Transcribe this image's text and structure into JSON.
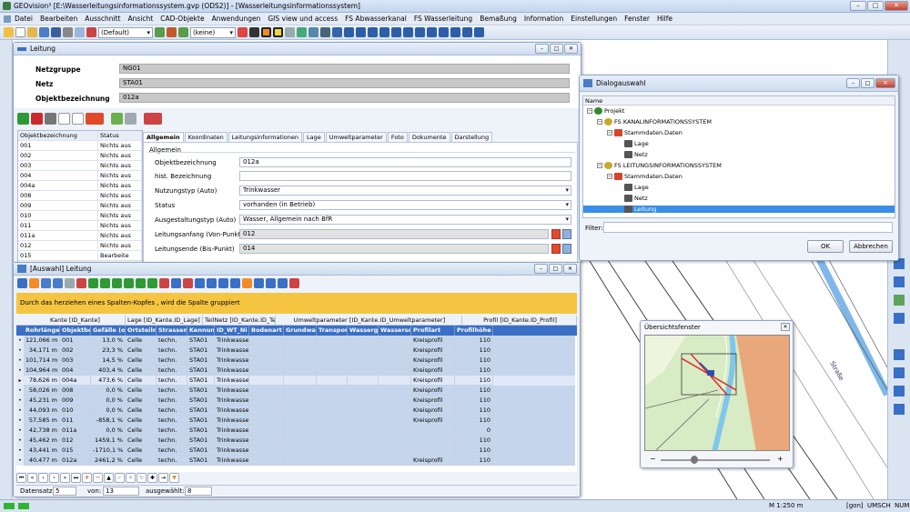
{
  "app": {
    "title": "GEOvision³ [E:\\Wasserleitungsinformationssystem.gvp (ODS2)] - [Wasserleitungsinformationssystem]"
  },
  "menu": [
    "Datei",
    "Bearbeiten",
    "Ausschnitt",
    "Ansicht",
    "CAD-Objekte",
    "Anwendungen",
    "GIS view und access",
    "FS Abwasserkanal",
    "FS Wasserleitung",
    "Bemaßung",
    "Information",
    "Einstellungen",
    "Fenster",
    "Hilfe"
  ],
  "toolbar": {
    "layer_combo": "(Default)",
    "filter_combo": "(keine)"
  },
  "leitung": {
    "title": "Leitung",
    "netzgruppe_label": "Netzgruppe",
    "netzgruppe": "NG01",
    "netz_label": "Netz",
    "netz": "STA01",
    "objbez_label": "Objektbezeichnung",
    "objbez": "012a",
    "list_headers": [
      "Objektbezeichnung",
      "Status"
    ],
    "list": [
      [
        "001",
        "Nichts aus"
      ],
      [
        "002",
        "Nichts aus"
      ],
      [
        "003",
        "Nichts aus"
      ],
      [
        "004",
        "Nichts aus"
      ],
      [
        "004a",
        "Nichts aus"
      ],
      [
        "008",
        "Nichts aus"
      ],
      [
        "009",
        "Nichts aus"
      ],
      [
        "010",
        "Nichts aus"
      ],
      [
        "011",
        "Nichts aus"
      ],
      [
        "011a",
        "Nichts aus"
      ],
      [
        "012",
        "Nichts aus"
      ],
      [
        "015",
        "Bearbeite"
      ]
    ],
    "tabs": [
      "Allgemein",
      "Koordinaten",
      "Leitungsinformationen",
      "Lage",
      "Umweltparameter",
      "Foto",
      "Dokumente",
      "Darstellung"
    ],
    "group": "Allgemein",
    "fields": [
      {
        "label": "Objektbezeichnung",
        "value": "012a",
        "kind": "text"
      },
      {
        "label": "hist. Bezeichnung",
        "value": "",
        "kind": "text"
      },
      {
        "label": "Nutzungstyp (Auto)",
        "value": "Trinkwasser",
        "kind": "select"
      },
      {
        "label": "Status",
        "value": "vorhanden (in Betrieb)",
        "kind": "select"
      },
      {
        "label": "Ausgestaltungstyp (Auto)",
        "value": "Wasser, Allgemein nach BfR",
        "kind": "select"
      },
      {
        "label": "Leitungsanfang (Von-Punkt)",
        "value": "012",
        "kind": "gray"
      },
      {
        "label": "Leitungsende (Bis-Punkt)",
        "value": "014",
        "kind": "gray"
      }
    ]
  },
  "auswahl": {
    "title": "[Auswahl] Leitung",
    "hint": "Durch das herziehen eines Spalten-Kopfes , wird die Spalte gruppiert",
    "groups": [
      "Kante [ID_Kante]",
      "Lage [ID_Kante.ID_Lage]",
      "TeilNetz [ID_Kante.ID_Te",
      "Umweltparameter [ID_Kante.ID_Umweltparameter]",
      "Profil [ID_Kante.ID_Profil]"
    ],
    "columns": [
      "Rohrlänge",
      "Objektbez",
      "Gefälle (of",
      "Ortsteilnar",
      "Strassenn",
      "Kennung",
      "ID_WT_Ni",
      "Bodenart",
      "Grundwas",
      "Transporti",
      "Wassergel",
      "Wasserscl",
      "Profilart",
      "Profilhöhe (D"
    ],
    "rows": [
      [
        "121,066 m",
        "001",
        "13,0 %",
        "Celle",
        "techn.",
        "STA01",
        "Trinkwasser",
        "",
        "",
        "",
        "",
        "",
        "Kreisprofil",
        "110"
      ],
      [
        "34,171 m",
        "002",
        "23,3 %",
        "Celle",
        "techn.",
        "STA01",
        "Trinkwasser",
        "",
        "",
        "",
        "",
        "",
        "Kreisprofil",
        "110"
      ],
      [
        "101,714 m",
        "003",
        "14,5 %",
        "Celle",
        "techn.",
        "STA01",
        "Trinkwasser",
        "",
        "",
        "",
        "",
        "",
        "Kreisprofil",
        "110"
      ],
      [
        "104,964 m",
        "004",
        "403,4 %",
        "Celle",
        "techn.",
        "STA01",
        "Trinkwasser",
        "",
        "",
        "",
        "",
        "",
        "Kreisprofil",
        "110"
      ],
      [
        "78,626 m",
        "004a",
        "473,6 %",
        "Celle",
        "techn.",
        "STA01",
        "Trinkwasser",
        "",
        "",
        "",
        "",
        "",
        "Kreisprofil",
        "110"
      ],
      [
        "58,026 m",
        "008",
        "0,0 %",
        "Celle",
        "techn.",
        "STA01",
        "Trinkwasser",
        "",
        "",
        "",
        "",
        "",
        "Kreisprofil",
        "110"
      ],
      [
        "45,231 m",
        "009",
        "0,0 %",
        "Celle",
        "techn.",
        "STA01",
        "Trinkwasser",
        "",
        "",
        "",
        "",
        "",
        "Kreisprofil",
        "110"
      ],
      [
        "44,093 m",
        "010",
        "0,0 %",
        "Celle",
        "techn.",
        "STA01",
        "Trinkwasser",
        "",
        "",
        "",
        "",
        "",
        "Kreisprofil",
        "110"
      ],
      [
        "57,585 m",
        "011",
        "-858,1 %",
        "Celle",
        "techn.",
        "STA01",
        "Trinkwasser",
        "",
        "",
        "",
        "",
        "",
        "Kreisprofil",
        "110"
      ],
      [
        "42,738 m",
        "011a",
        "0,0 %",
        "Celle",
        "techn.",
        "STA01",
        "Trinkwasser",
        "",
        "",
        "",
        "",
        "",
        "",
        "0"
      ],
      [
        "45,462 m",
        "012",
        "1459,1 %",
        "Celle",
        "techn.",
        "STA01",
        "Trinkwasser",
        "",
        "",
        "",
        "",
        "",
        "",
        "110"
      ],
      [
        "43,441 m",
        "015",
        "-1710,1 %",
        "Celle",
        "techn.",
        "STA01",
        "Trinkwasser",
        "",
        "",
        "",
        "",
        "",
        "",
        "110"
      ],
      [
        "40,477 m",
        "012a",
        "2461,2 %",
        "Celle",
        "techn.",
        "STA01",
        "Trinkwasser",
        "",
        "",
        "",
        "",
        "",
        "Kreisprofil",
        "110"
      ]
    ],
    "status": {
      "datensatz_label": "Datensatz:",
      "datensatz": "5",
      "von_label": "von:",
      "von": "13",
      "ausgewaehlt_label": "ausgewählt:",
      "ausgewaehlt": "8"
    }
  },
  "dialog": {
    "title": "Dialogauswahl",
    "name_header": "Name",
    "tree": [
      {
        "label": "Projekt",
        "level": 0
      },
      {
        "label": "FS KANALINFORMATIONSSYSTEM",
        "level": 1
      },
      {
        "label": "Stammdaten.Daten",
        "level": 2
      },
      {
        "label": "Lage",
        "level": 3
      },
      {
        "label": "Netz",
        "level": 3
      },
      {
        "label": "FS LEITUNGSINFORMATIONSSYSTEM",
        "level": 1
      },
      {
        "label": "Stammdaten.Daten",
        "level": 2
      },
      {
        "label": "Lage",
        "level": 3
      },
      {
        "label": "Netz",
        "level": 3
      },
      {
        "label": "Leitung",
        "level": 3
      }
    ],
    "filter_label": "Filter:",
    "ok": "OK",
    "cancel": "Abbrechen"
  },
  "overview": {
    "title": "Übersichtsfenster",
    "minus": "−",
    "plus": "+"
  },
  "map": {
    "street_label": "Straße"
  },
  "statusbar": {
    "scale": "M 1:250 m",
    "gon": "[gon]",
    "umsch": "UMSCH",
    "num": "NUM"
  },
  "colors": {
    "selection": "#3a6fc5",
    "hint_bar": "#f5c542",
    "grid_row": "#c5d6ec"
  }
}
